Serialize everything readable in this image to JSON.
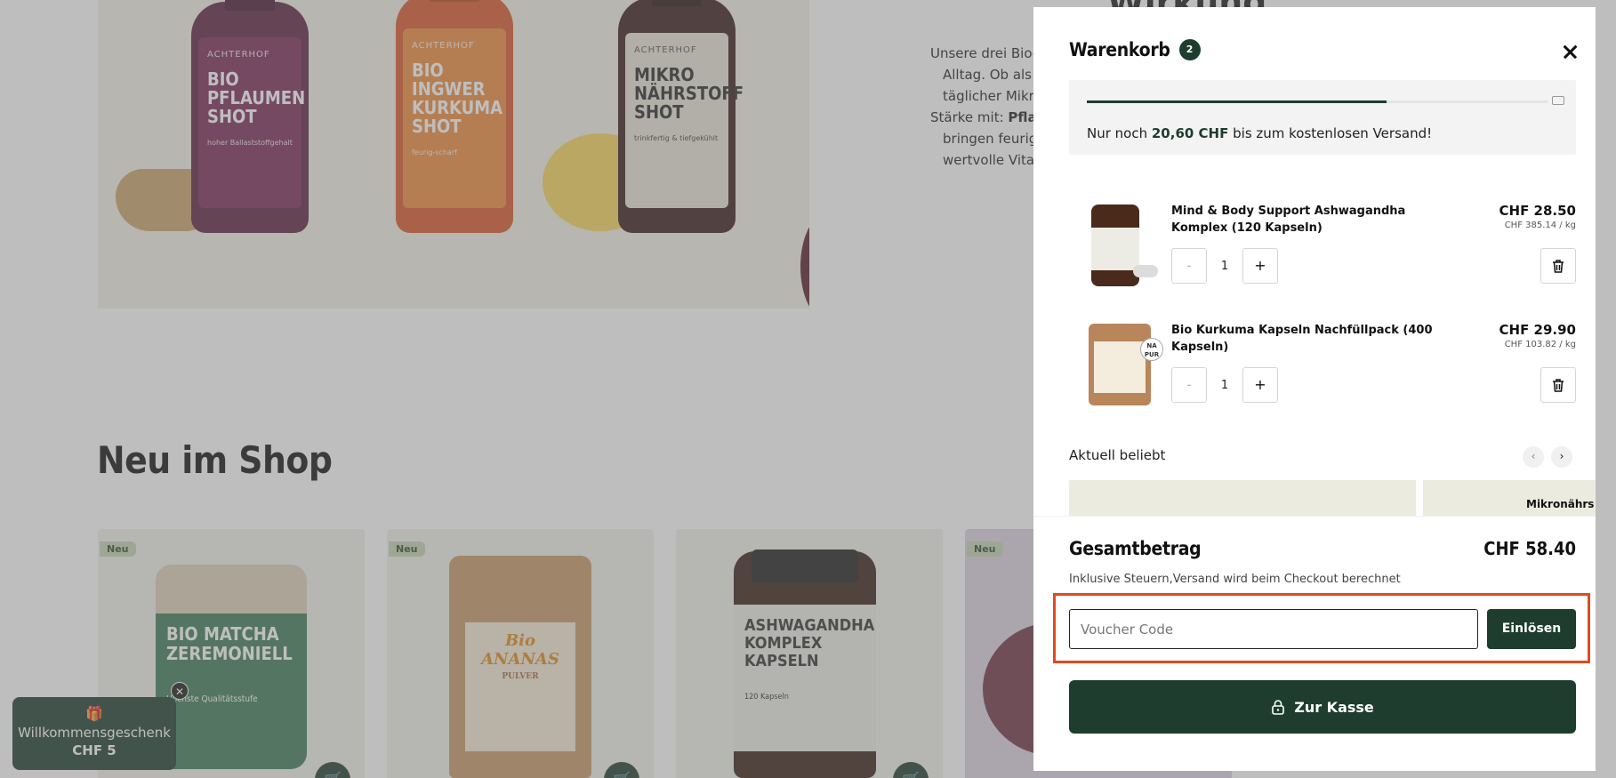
{
  "background": {
    "hero_bottles": [
      {
        "brand": "ACHTERHOF",
        "name": "BIO PFLAUMEN SHOT",
        "sub": "hoher Ballaststoffgehalt"
      },
      {
        "brand": "ACHTERHOF",
        "name": "BIO INGWER KURKUMA SHOT",
        "sub": "feurig-scharf"
      },
      {
        "brand": "ACHTERHOF",
        "name": "MIKRO NÄHRSTOFF SHOT",
        "sub": "trinkfertig & tiefgekühlt"
      }
    ],
    "section_heading": "Wirkung",
    "wirkung_lines": [
      "Unsere drei Bio-S",
      "Alltag. Ob als B",
      "täglicher Mikro",
      "Stärke mit: ",
      "bringen feurige",
      "wertvolle Vitar"
    ],
    "wirkung_bold": "Pflaum",
    "neu_title": "Neu im Shop",
    "new_badge": "Neu",
    "products": [
      {
        "label": "BIO MATCHA ZEREMONIELL",
        "sub": "Höchste Qualitätsstufe"
      },
      {
        "label": "Bio ANANAS",
        "sub": "PULVER"
      },
      {
        "label": "ASHWAGANDHA KOMPLEX KAPSELN",
        "sub": "120 Kapseln"
      },
      {
        "label": "",
        "sub": ""
      }
    ],
    "welcome_gift": {
      "label": "Willkommensgeschenk",
      "value": "CHF 5"
    }
  },
  "cart": {
    "title": "Warenkorb",
    "count": "2",
    "shipping": {
      "prefix": "Nur noch ",
      "amount": "20,60 CHF",
      "suffix": " bis zum kostenlosen Versand!",
      "progress": 0.65
    },
    "items": [
      {
        "name": "Mind & Body Support Ashwagandha Komplex (120 Kapseln)",
        "price": "CHF 28.50",
        "unit_price": "CHF 385.14 / kg",
        "quantity": "1",
        "minus": "-",
        "plus": "+"
      },
      {
        "name": "Bio Kurkuma Kapseln Nachfüllpack (400 Kapseln)",
        "price": "CHF 29.90",
        "unit_price": "CHF 103.82 / kg",
        "quantity": "1",
        "minus": "-",
        "plus": "+",
        "badge": "NA PUR"
      }
    ],
    "popular": {
      "label": "Aktuell beliebt",
      "prev": "‹",
      "next": "›",
      "card2_title": "Mikronährs"
    },
    "total_label": "Gesamtbetrag",
    "total_value": "CHF 58.40",
    "total_note": "Inklusive Steuern,Versand wird beim Checkout berechnet",
    "voucher": {
      "placeholder": "Voucher Code",
      "value": "",
      "button": "Einlösen"
    },
    "checkout": "Zur Kasse"
  },
  "colors": {
    "brand_green": "#1e3d2f",
    "highlight": "#e04b1a"
  }
}
